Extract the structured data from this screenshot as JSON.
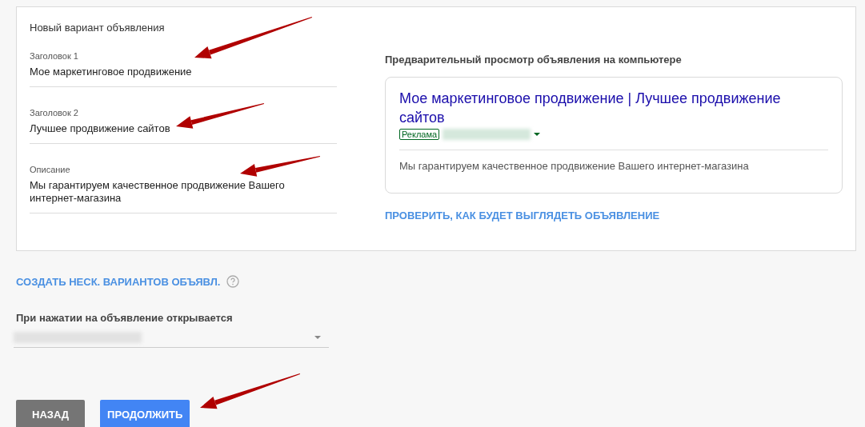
{
  "editor": {
    "title": "Новый вариант объявления",
    "fields": [
      {
        "label": "Заголовок 1",
        "value": "Мое маркетинговое продвижение"
      },
      {
        "label": "Заголовок 2",
        "value": "Лучшее продвижение сайтов"
      },
      {
        "label": "Описание",
        "value": "Мы гарантируем качественное продвижение Вашего интернет-магазина"
      }
    ]
  },
  "preview": {
    "title": "Предварительный просмотр объявления на компьютере",
    "ad_headline": "Мое маркетинговое продвижение | Лучшее продвижение сайтов",
    "ad_badge": "Реклама",
    "ad_description": "Мы гарантируем качественное продвижение Вашего интернет-магазина",
    "check_link": "ПРОВЕРИТЬ, КАК БУДЕТ ВЫГЛЯДЕТЬ ОБЪЯВЛЕНИЕ"
  },
  "variants_link": "СОЗДАТЬ НЕСК. ВАРИАНТОВ ОБЪЯВЛ.",
  "final_url": {
    "label": "При нажатии на объявление открывается"
  },
  "buttons": [
    {
      "label": "НАЗАД",
      "kind": "secondary"
    },
    {
      "label": "ПРОДОЛЖИТЬ",
      "kind": "primary"
    }
  ]
}
